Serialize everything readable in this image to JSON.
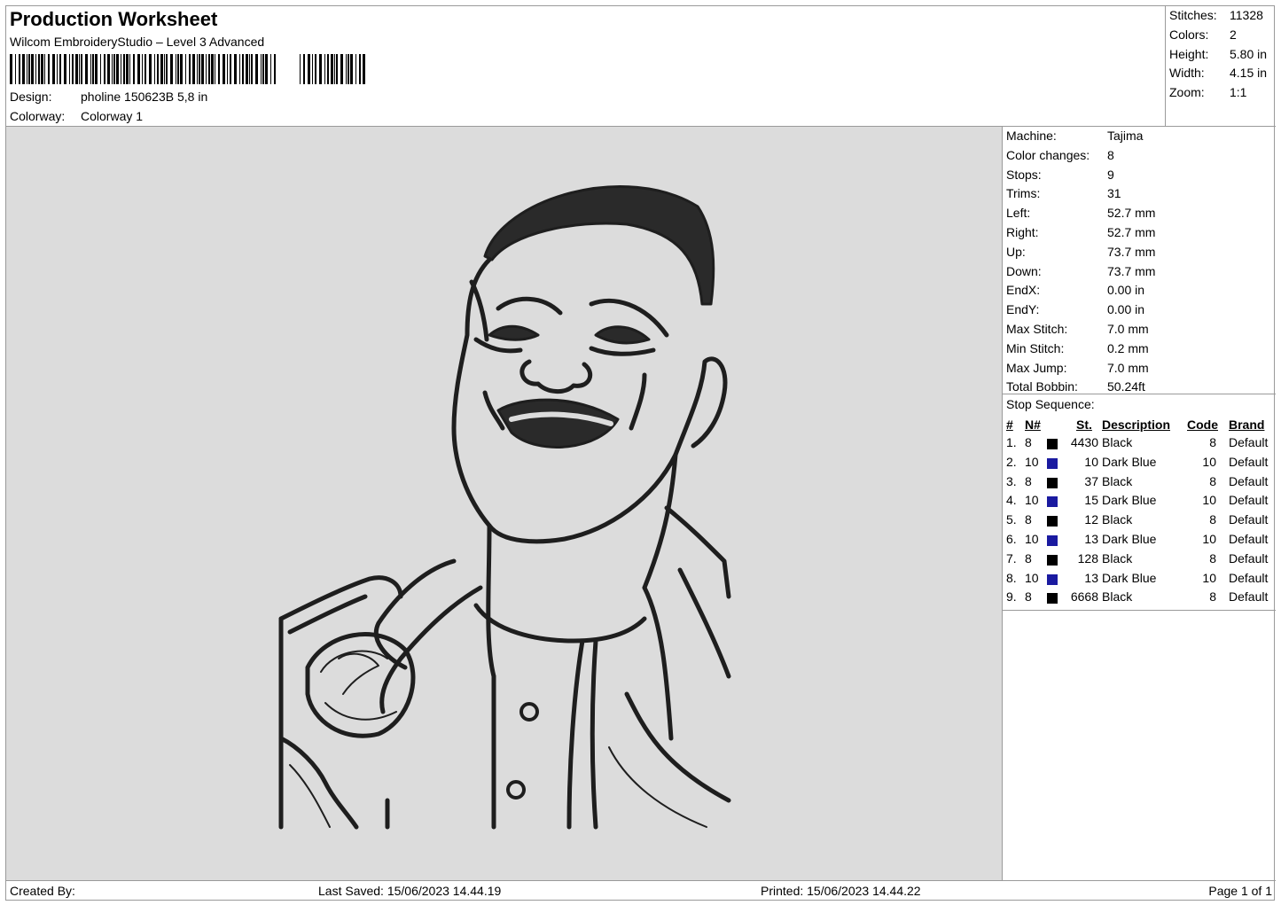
{
  "header": {
    "title": "Production Worksheet",
    "software": "Wilcom EmbroideryStudio – Level 3 Advanced",
    "design_label": "Design:",
    "design_value": "pholine 150623B 5,8 in",
    "colorway_label": "Colorway:",
    "colorway_value": "Colorway 1"
  },
  "summary": [
    {
      "label": "Stitches:",
      "value": "11328"
    },
    {
      "label": "Colors:",
      "value": "2"
    },
    {
      "label": "Height:",
      "value": "5.80 in"
    },
    {
      "label": "Width:",
      "value": "4.15 in"
    },
    {
      "label": "Zoom:",
      "value": "1:1"
    }
  ],
  "machine_stats": [
    {
      "label": "Machine:",
      "value": "Tajima"
    },
    {
      "label": "Color changes:",
      "value": "8"
    },
    {
      "label": "Stops:",
      "value": "9"
    },
    {
      "label": "Trims:",
      "value": "31"
    },
    {
      "label": "Left:",
      "value": "52.7 mm"
    },
    {
      "label": "Right:",
      "value": "52.7 mm"
    },
    {
      "label": "Up:",
      "value": "73.7 mm"
    },
    {
      "label": "Down:",
      "value": "73.7 mm"
    },
    {
      "label": "EndX:",
      "value": "0.00 in"
    },
    {
      "label": "EndY:",
      "value": "0.00 in"
    },
    {
      "label": "Max Stitch:",
      "value": "7.0 mm"
    },
    {
      "label": "Min Stitch:",
      "value": "0.2 mm"
    },
    {
      "label": "Max Jump:",
      "value": "7.0 mm"
    },
    {
      "label": "Total Bobbin:",
      "value": "50.24ft"
    }
  ],
  "stop_sequence": {
    "title": "Stop Sequence:",
    "columns": {
      "num": "#",
      "needle": "N#",
      "stitches": "St.",
      "description": "Description",
      "code": "Code",
      "brand": "Brand"
    },
    "rows": [
      {
        "num": "1.",
        "needle": "8",
        "color": "#000000",
        "stitches": "4430",
        "description": "Black",
        "code": "8",
        "brand": "Default"
      },
      {
        "num": "2.",
        "needle": "10",
        "color": "#1a1aa0",
        "stitches": "10",
        "description": "Dark Blue",
        "code": "10",
        "brand": "Default"
      },
      {
        "num": "3.",
        "needle": "8",
        "color": "#000000",
        "stitches": "37",
        "description": "Black",
        "code": "8",
        "brand": "Default"
      },
      {
        "num": "4.",
        "needle": "10",
        "color": "#1a1aa0",
        "stitches": "15",
        "description": "Dark Blue",
        "code": "10",
        "brand": "Default"
      },
      {
        "num": "5.",
        "needle": "8",
        "color": "#000000",
        "stitches": "12",
        "description": "Black",
        "code": "8",
        "brand": "Default"
      },
      {
        "num": "6.",
        "needle": "10",
        "color": "#1a1aa0",
        "stitches": "13",
        "description": "Dark Blue",
        "code": "10",
        "brand": "Default"
      },
      {
        "num": "7.",
        "needle": "8",
        "color": "#000000",
        "stitches": "128",
        "description": "Black",
        "code": "8",
        "brand": "Default"
      },
      {
        "num": "8.",
        "needle": "10",
        "color": "#1a1aa0",
        "stitches": "13",
        "description": "Dark Blue",
        "code": "10",
        "brand": "Default"
      },
      {
        "num": "9.",
        "needle": "8",
        "color": "#000000",
        "stitches": "6668",
        "description": "Black",
        "code": "8",
        "brand": "Default"
      }
    ]
  },
  "footer": {
    "created_by": "Created By:",
    "last_saved": "Last Saved: 15/06/2023 14.44.19",
    "printed": "Printed: 15/06/2023 14.44.22",
    "page": "Page 1 of 1"
  }
}
